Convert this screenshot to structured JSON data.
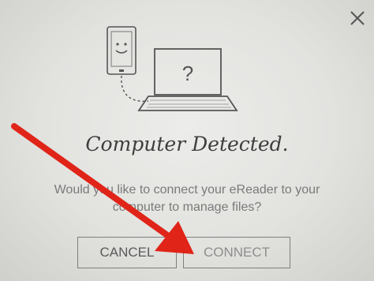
{
  "dialog": {
    "title": "Computer Detected.",
    "message_line1": "Would you like to connect your eReader to your",
    "message_line2": "computer to manage files?",
    "screen_glyph": "?",
    "cancel_label": "CANCEL",
    "connect_label": "CONNECT"
  },
  "icons": {
    "close": "close-icon",
    "ereader": "ereader-icon",
    "laptop": "laptop-icon",
    "annotation_arrow": "red-arrow-icon"
  },
  "colors": {
    "annotation_arrow": "#e02418",
    "text": "#3e3e3e",
    "muted_text": "#7a7a7a"
  }
}
